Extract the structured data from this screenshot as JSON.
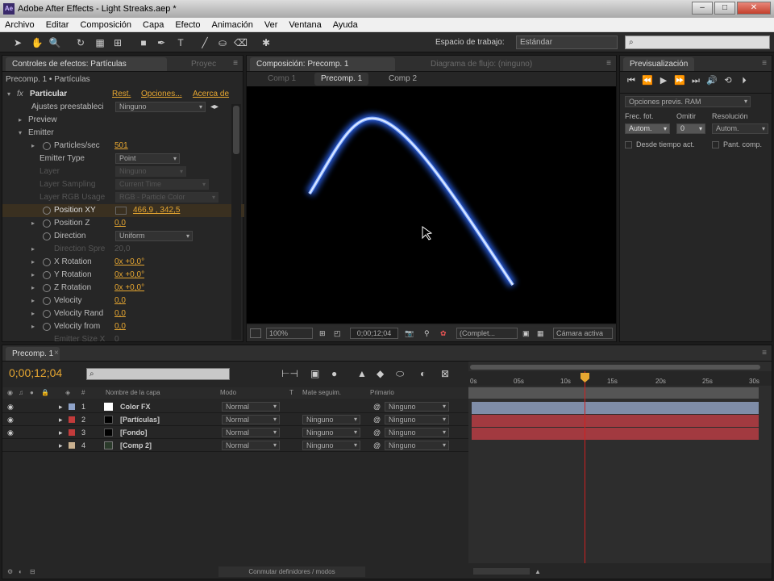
{
  "app": {
    "title": "Adobe After Effects - Light Streaks.aep *",
    "logo": "Ae",
    "win_min": "–",
    "win_max": "□",
    "win_close": "✕"
  },
  "menu": [
    "Archivo",
    "Editar",
    "Composición",
    "Capa",
    "Efecto",
    "Animación",
    "Ver",
    "Ventana",
    "Ayuda"
  ],
  "toolbar": {
    "workspace_label": "Espacio de trabajo:",
    "workspace_value": "Estándar",
    "search_placeholder": ""
  },
  "effects_panel": {
    "tab1": "Controles de efectos: Partículas",
    "tab2": "Proyec",
    "breadcrumb": "Precomp. 1 • Partículas",
    "effect_name": "Particular",
    "reset": "Rest.",
    "options": "Opciones...",
    "about": "Acerca de",
    "preset_label": "Ajustes preestableci",
    "preset_value": "Ninguno",
    "preview": "Preview",
    "emitter": "Emitter",
    "particles_sec_label": "Particles/sec",
    "particles_sec_value": "501",
    "emitter_type_label": "Emitter Type",
    "emitter_type_value": "Point",
    "layer_label": "Layer",
    "layer_value": "Ninguno",
    "layer_sampling_label": "Layer Sampling",
    "layer_sampling_value": "Current Time",
    "layer_rgb_label": "Layer RGB Usage",
    "layer_rgb_value": "RGB - Particle Color",
    "position_xy_label": "Position XY",
    "position_xy_value": "466,9 , 342,5",
    "position_z_label": "Position Z",
    "position_z_value": "0,0",
    "direction_label": "Direction",
    "direction_value": "Uniform",
    "direction_spread_label": "Direction Spre",
    "direction_spread_value": "20,0",
    "x_rot_label": "X Rotation",
    "x_rot_value": "0x +0,0°",
    "y_rot_label": "Y Rotation",
    "y_rot_value": "0x +0,0°",
    "z_rot_label": "Z Rotation",
    "z_rot_value": "0x +0,0°",
    "velocity_label": "Velocity",
    "velocity_value": "0,0",
    "velocity_rand_label": "Velocity Rand",
    "velocity_rand_value": "0,0",
    "velocity_from_label": "Velocity from",
    "velocity_from_value": "0,0",
    "emitter_size_label": "Emitter Size X",
    "emitter_size_value": "0"
  },
  "comp_panel": {
    "tab1": "Composición: Precomp. 1",
    "tab2": "Diagrama de flujo: (ninguno)",
    "subtabs": [
      "Comp 1",
      "Precomp. 1",
      "Comp 2"
    ],
    "zoom": "100%",
    "timecode": "0;00;12;04",
    "quality": "(Complet...",
    "camera": "Cámara activa"
  },
  "preview_panel": {
    "tab": "Previsualización",
    "ram_options": "Opciones previs. RAM",
    "frame_rate_label": "Frec. fot.",
    "skip_label": "Omitir",
    "resolution_label": "Resolución",
    "frame_rate_value": "Autom.",
    "skip_value": "0",
    "resolution_value": "Autom.",
    "from_current": "Desde tiempo act.",
    "full_screen": "Pant. comp."
  },
  "timeline": {
    "tab": "Precomp. 1",
    "timecode": "0;00;12;04",
    "col_name": "Nombre de la capa",
    "col_mode": "Modo",
    "col_t": "T",
    "col_matte": "Mate seguim.",
    "col_parent": "Primario",
    "layers": [
      {
        "num": "1",
        "name": "Color FX",
        "color": "#8fa3c9",
        "swatch": "#ffffff",
        "mode": "Normal",
        "matte": "",
        "parent": "Ninguno",
        "bar": "#7f8da8"
      },
      {
        "num": "2",
        "name": "[Partículas]",
        "color": "#c23b3b",
        "swatch": "#000000",
        "mode": "Normal",
        "matte": "Ninguno",
        "parent": "Ninguno",
        "bar": "#a23a40"
      },
      {
        "num": "3",
        "name": "[Fondo]",
        "color": "#c23b3b",
        "swatch": "#000000",
        "mode": "Normal",
        "matte": "Ninguno",
        "parent": "Ninguno",
        "bar": "#a23a40"
      },
      {
        "num": "4",
        "name": "[Comp 2]",
        "color": "#c9b08f",
        "swatch": "#2a3a2a",
        "mode": "Normal",
        "matte": "Ninguno",
        "parent": "Ninguno",
        "bar": ""
      }
    ],
    "ruler": [
      "0s",
      "05s",
      "10s",
      "15s",
      "20s",
      "25s",
      "30s"
    ],
    "footer": "Conmutar definidores / modos"
  },
  "colors": {
    "accent": "#e7a731",
    "playhead": "#d02020"
  }
}
